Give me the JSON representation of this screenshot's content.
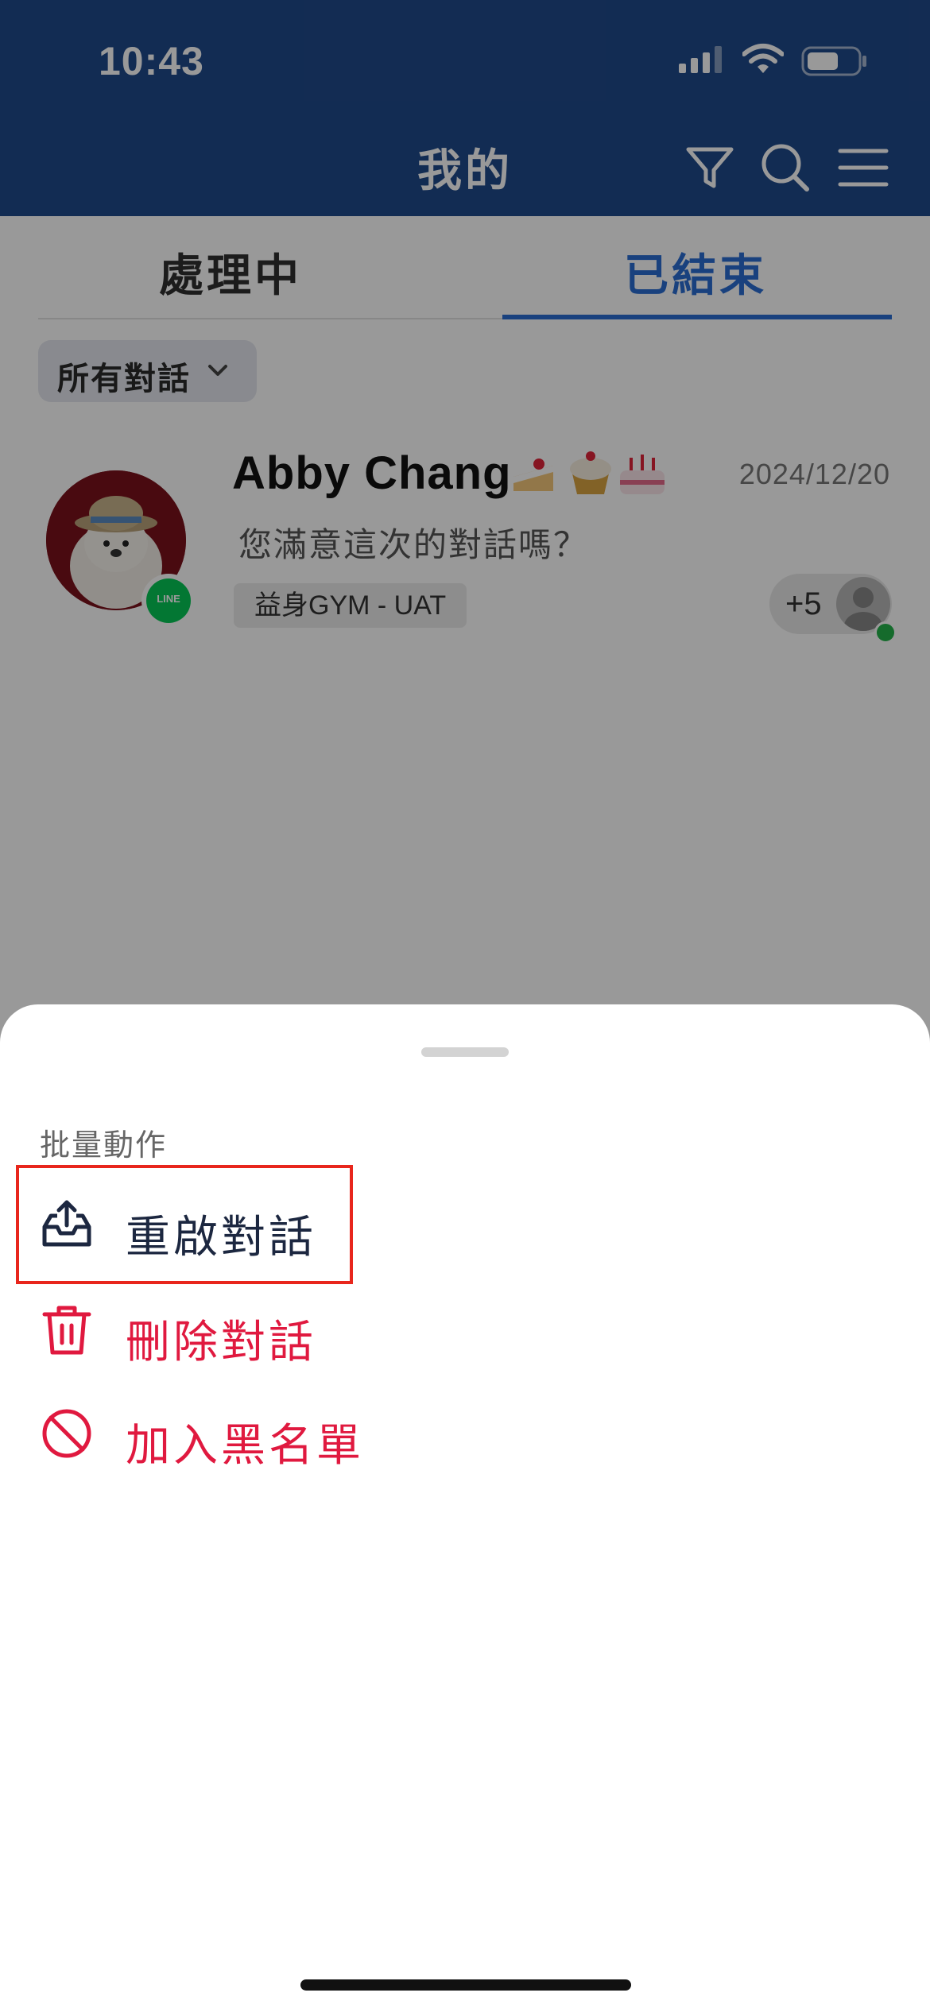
{
  "status_bar": {
    "time": "10:43",
    "signal_icon": "cellular-signal-icon",
    "wifi_icon": "wifi-icon",
    "battery_icon": "battery-icon"
  },
  "nav": {
    "title": "我的",
    "filter_icon": "filter-icon",
    "search_icon": "search-icon",
    "menu_icon": "hamburger-menu-icon"
  },
  "tabs": [
    {
      "label": "處理中",
      "selected": false
    },
    {
      "label": "已結束",
      "selected": true
    }
  ],
  "filter_chip": {
    "label": "所有對話",
    "icon": "chevron-down-icon"
  },
  "conversation": {
    "name": "Abby Chang",
    "emojis": [
      "🍰",
      "🧁",
      "🎂"
    ],
    "date": "2024/12/20",
    "last_message": "您滿意這次的對話嗎？",
    "channel_tag": "益身GYM - UAT",
    "channel_badge": "LINE",
    "agents_count": "+5",
    "agent_online": true
  },
  "bottom_sheet": {
    "title": "批量動作",
    "items": [
      {
        "label": "重啟對話",
        "icon": "inbox-reopen-icon",
        "color": "#1c2740",
        "highlighted": true
      },
      {
        "label": "刪除對話",
        "icon": "trash-icon",
        "color": "#e0193f"
      },
      {
        "label": "加入黑名單",
        "icon": "block-icon",
        "color": "#e0193f"
      }
    ]
  },
  "colors": {
    "header": "#1f4a8a",
    "accent": "#2a6dd2",
    "danger": "#e0193f",
    "highlight": "#e8261c",
    "online": "#23b24a"
  }
}
